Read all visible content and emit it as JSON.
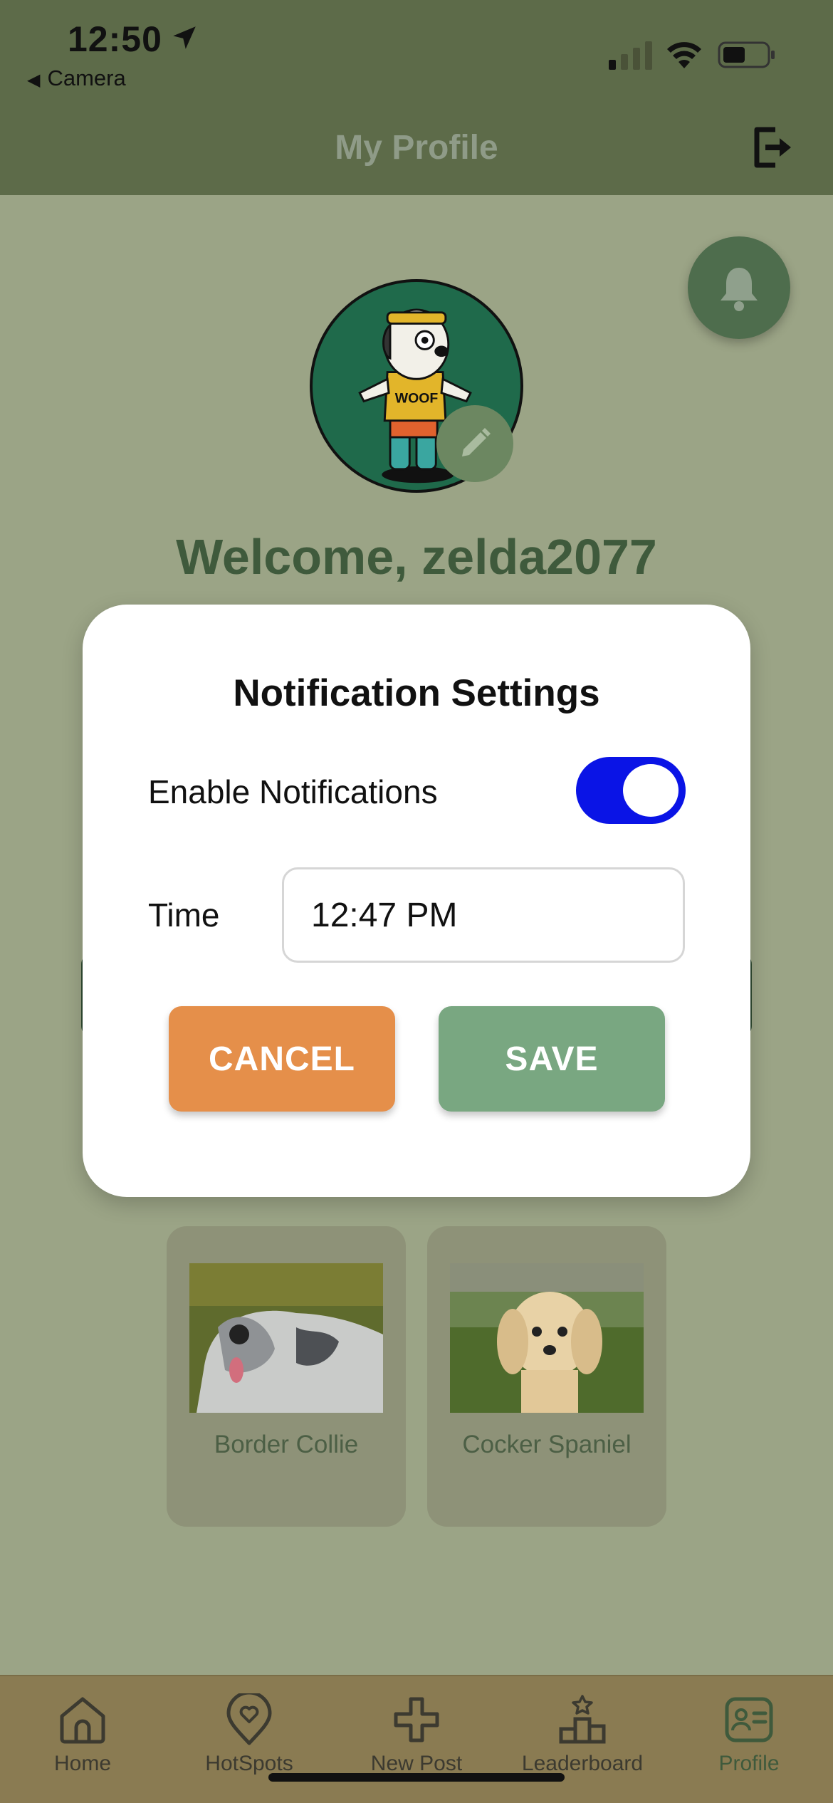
{
  "status_bar": {
    "time": "12:50",
    "back_label": "Camera",
    "icons": [
      "location-arrow-icon",
      "cellular-signal-icon",
      "wifi-icon",
      "battery-icon"
    ]
  },
  "header": {
    "title": "My Profile",
    "logout_icon": "logout-icon"
  },
  "profile": {
    "welcome": "Welcome, zelda2077",
    "notification_icon": "bell-icon",
    "edit_icon": "pencil-icon"
  },
  "favorites": [
    {
      "name": "Border Collie"
    },
    {
      "name": "Cocker Spaniel"
    }
  ],
  "modal": {
    "title": "Notification Settings",
    "enable_label": "Enable Notifications",
    "enabled": true,
    "time_label": "Time",
    "time_value": "12:47 PM",
    "cancel_label": "CANCEL",
    "save_label": "SAVE"
  },
  "tabbar": {
    "items": [
      {
        "label": "Home",
        "icon": "home-icon"
      },
      {
        "label": "HotSpots",
        "icon": "map-pin-icon"
      },
      {
        "label": "New Post",
        "icon": "plus-icon"
      },
      {
        "label": "Leaderboard",
        "icon": "podium-icon"
      },
      {
        "label": "Profile",
        "icon": "id-card-icon"
      }
    ],
    "active": "Profile"
  },
  "colors": {
    "header_bg": "#5d6b49",
    "page_bg": "#9ba486",
    "toggle_on": "#0a14e6",
    "cancel": "#e58f4a",
    "save": "#79a781"
  }
}
